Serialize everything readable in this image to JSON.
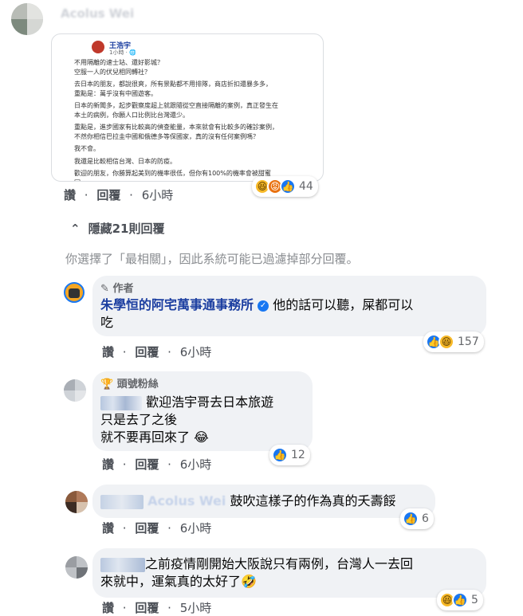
{
  "top_comment": {
    "author_name": "Acolus Wei",
    "post_image": {
      "poster_name": "王浩宇",
      "poster_meta": "1小時 · 🌐",
      "lines": [
        "不用隔離的速士站、還好影城？",
        "空服一人的伏兒相同轉社？",
        "",
        "去日本的朋友，都說很爽，所有景點都不用排隊，商店折扣還暴多多，",
        "重點是：萬乎沒有中國遊客。",
        "",
        "日本的新聞多，起步觀察度超上就跟隨從空直接隔離的案例，真正發生在",
        "本土的病例，你願人口比例比台灣還少。",
        "",
        "重點是，進步國家有比較高的偵查能量，本來就會有比較多的確診案例，",
        "不然你相信巴拉圭中國和俄德多等保國家，真的沒有任何案例嗎？",
        "",
        "我不會。",
        "",
        "我還是比較相信台灣、日本的防疫。",
        "",
        "歡迎的朋友，你勝算起美到的機率很低，但你有100%的機率會被甜蜜",
        "冥。"
      ]
    },
    "actions": [
      "讚",
      "回覆",
      "6小時"
    ],
    "reaction_count": "44"
  },
  "hide_replies": "隱藏21則回覆",
  "filter_notice": "你選擇了「最相關」，因此系統可能已過濾掉部分回覆。",
  "replies": [
    {
      "badge": "作者",
      "author": "朱學恒的阿宅萬事通事務所",
      "text_line1": "他的話可以聽，屎都可以",
      "text_line2": "吃",
      "actions": [
        "讚",
        "回覆",
        "6小時"
      ],
      "reaction_count": "157"
    },
    {
      "badge": "頭號粉絲",
      "text_line1": "歡迎浩宇哥去日本旅遊",
      "text_line2": "只是去了之後",
      "text_line3": "就不要再回來了 😂",
      "actions": [
        "讚",
        "回覆",
        "6小時"
      ],
      "reaction_count": "12"
    },
    {
      "mention_blur": "Acolus Wei",
      "text": "鼓吹這樣子的作為真的夭壽餒",
      "actions": [
        "讚",
        "回覆",
        "6小時"
      ],
      "reaction_count": "6"
    },
    {
      "text_line1": "之前疫情剛開始大阪說只有兩例，台灣人一去回",
      "text_line2": "來就中，運氣真的太好了🤣",
      "actions": [
        "讚",
        "回覆",
        "5小時"
      ],
      "reaction_count": "5"
    }
  ],
  "colors": {
    "link_blue": "#1b3ea0",
    "verified": "#1877f2",
    "bubble": "#f0f2f5",
    "muted": "#65676b"
  }
}
